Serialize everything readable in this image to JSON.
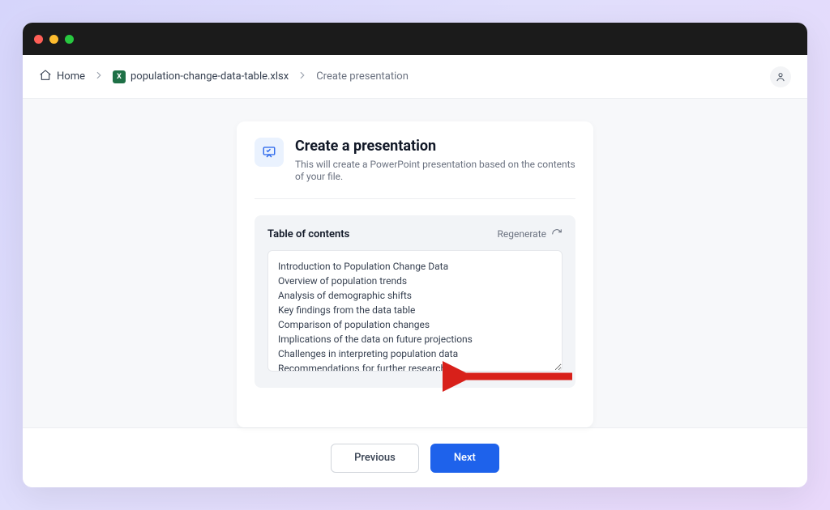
{
  "breadcrumb": {
    "home": "Home",
    "file": "population-change-data-table.xlsx",
    "current": "Create presentation"
  },
  "card": {
    "title": "Create a presentation",
    "description": "This will create a PowerPoint presentation based on the contents of your file."
  },
  "toc": {
    "title": "Table of contents",
    "regenerate_label": "Regenerate",
    "items": [
      "Introduction to Population Change Data",
      "Overview of population trends",
      "Analysis of demographic shifts",
      "Key findings from the data table",
      "Comparison of population changes",
      "Implications of the data on future projections",
      "Challenges in interpreting population data",
      "Recommendations for further research"
    ]
  },
  "footer": {
    "previous": "Previous",
    "next": "Next"
  },
  "colors": {
    "primary": "#1e62eb",
    "panel_bg": "#f2f4f7",
    "workspace_bg": "#f7f8fa"
  }
}
